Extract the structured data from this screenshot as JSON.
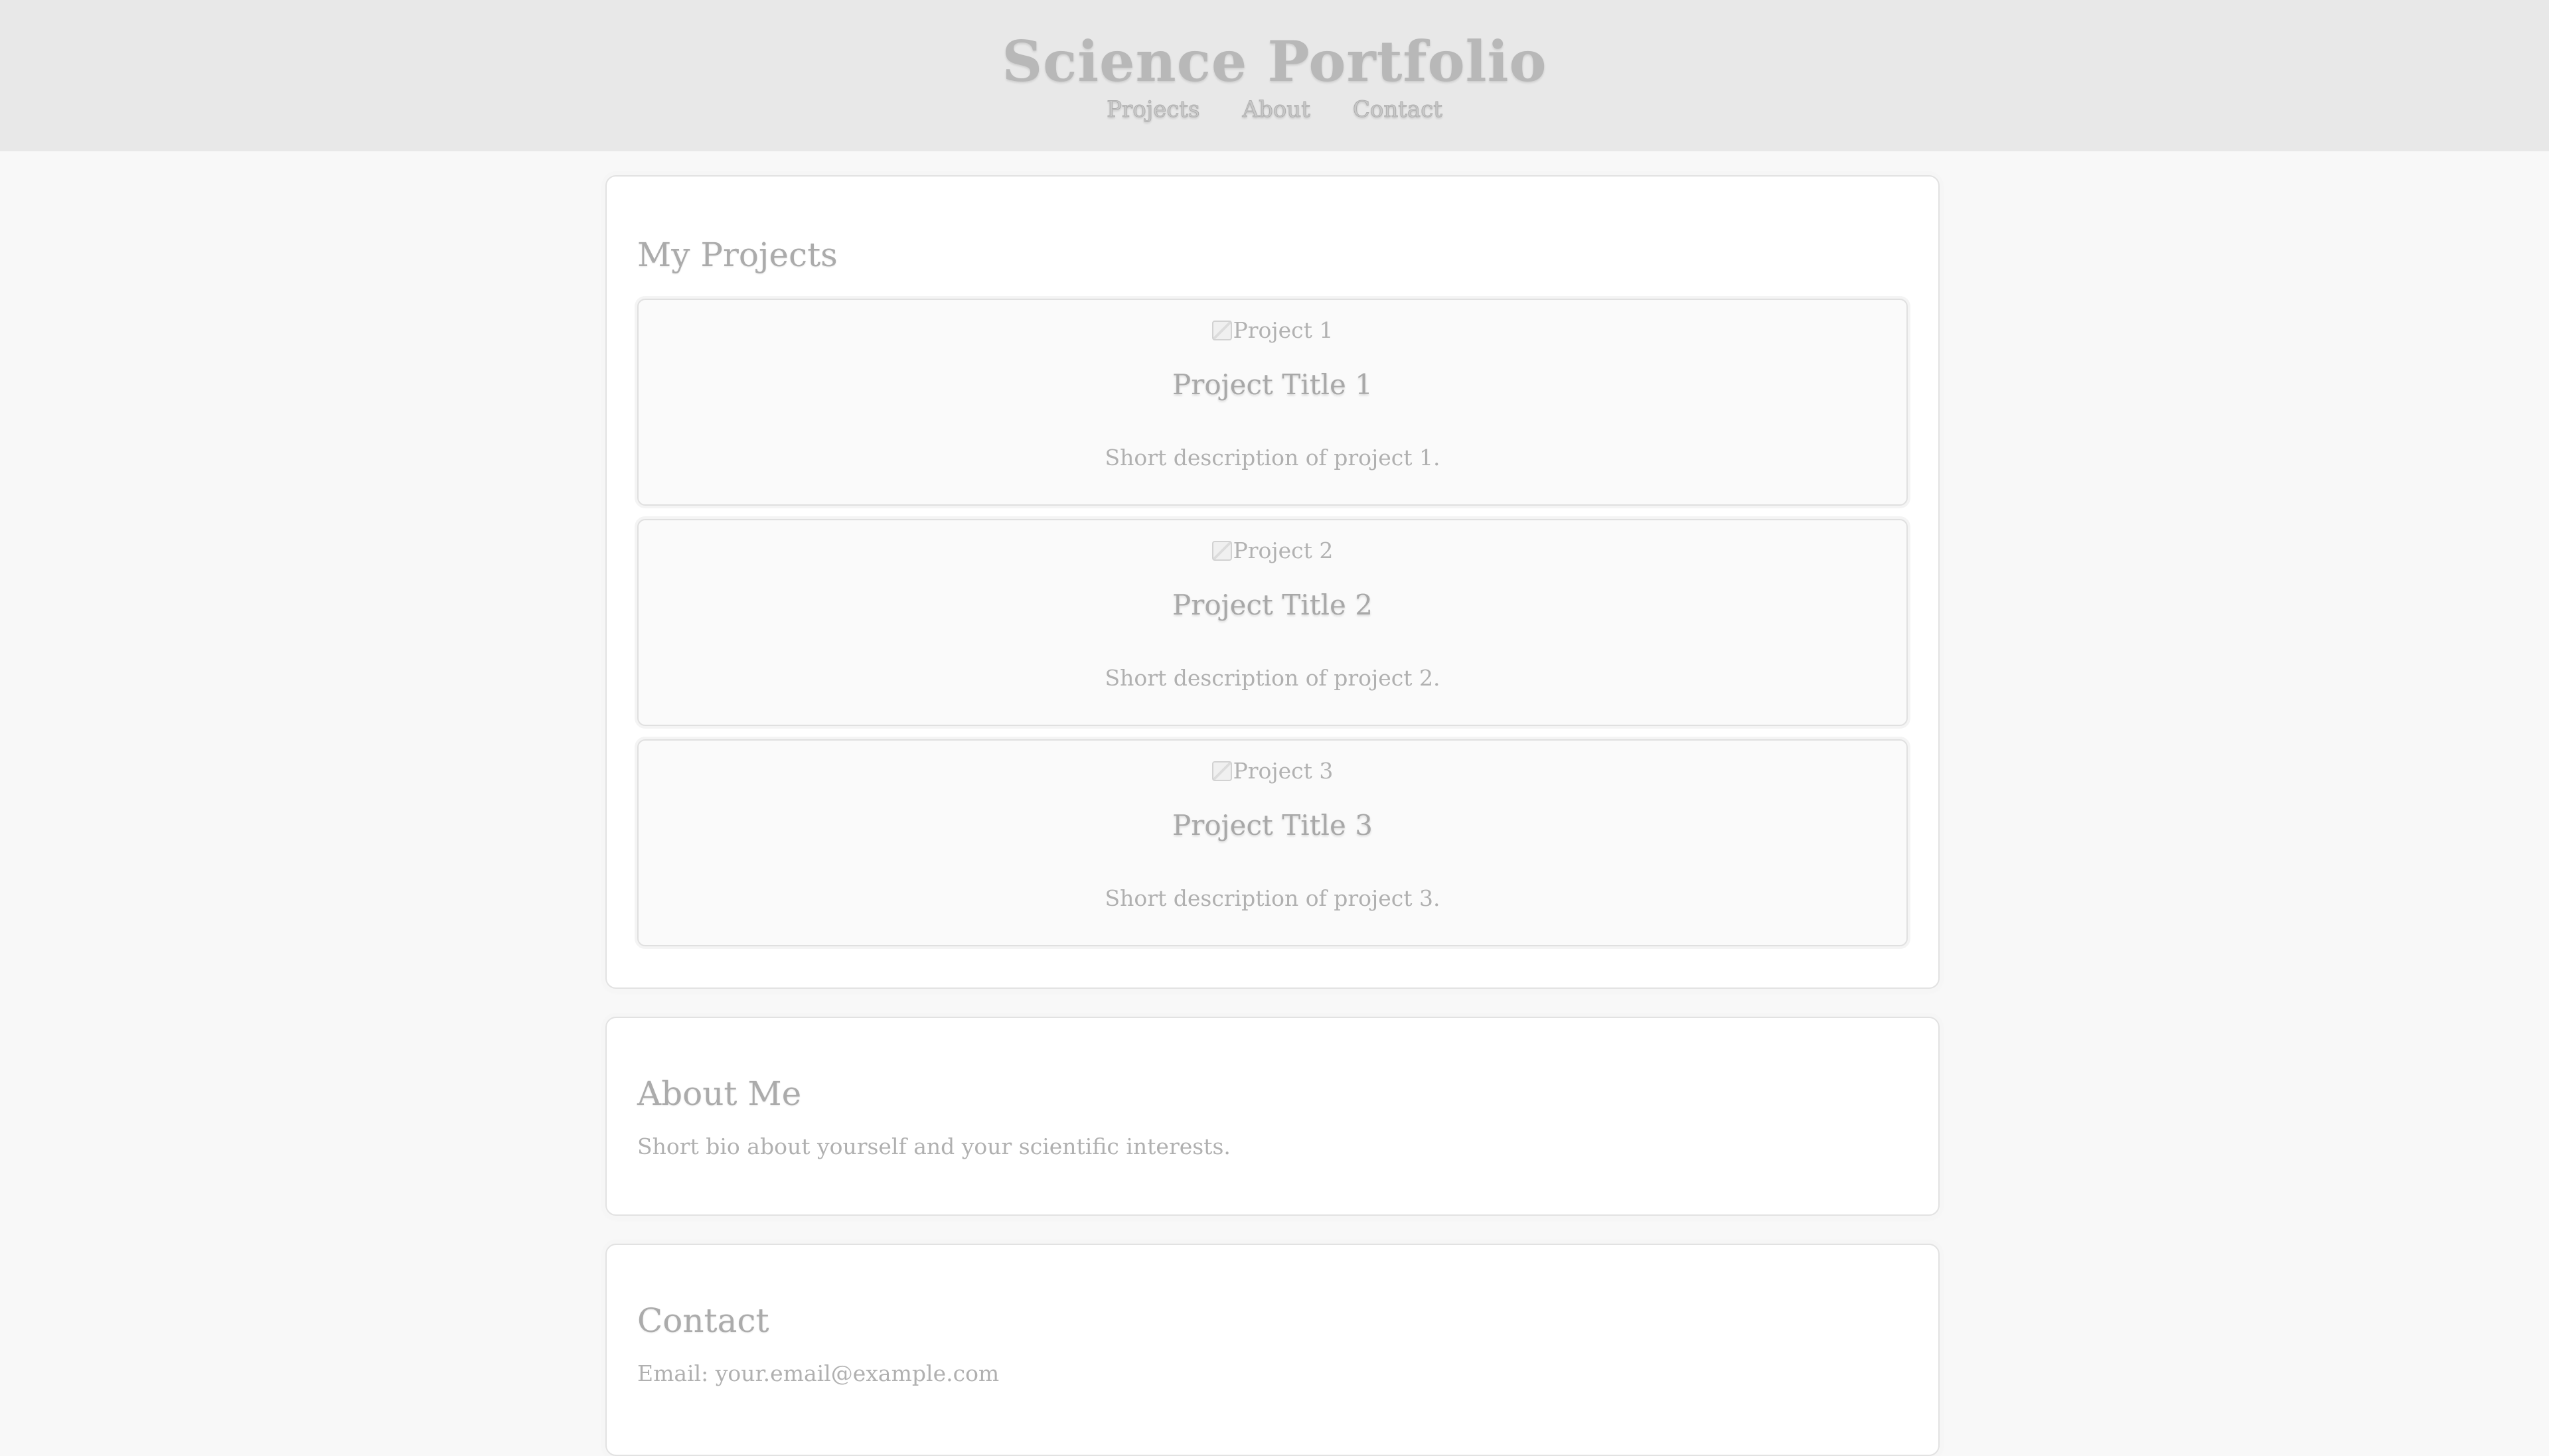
{
  "header": {
    "title": "Science Portfolio",
    "nav": [
      "Projects",
      "About",
      "Contact"
    ]
  },
  "projects": {
    "heading": "My Projects",
    "items": [
      {
        "image_alt": "Project 1",
        "title": "Project Title 1",
        "description": "Short description of project 1."
      },
      {
        "image_alt": "Project 2",
        "title": "Project Title 2",
        "description": "Short description of project 2."
      },
      {
        "image_alt": "Project 3",
        "title": "Project Title 3",
        "description": "Short description of project 3."
      }
    ]
  },
  "about": {
    "heading": "About Me",
    "text": "Short bio about yourself and your scientific interests."
  },
  "contact": {
    "heading": "Contact",
    "email_label": "Email: your.email@example.com"
  },
  "colors": {
    "header_background": "#e8e8e8",
    "page_background": "#f8f8f8",
    "card_background": "#ffffff"
  }
}
